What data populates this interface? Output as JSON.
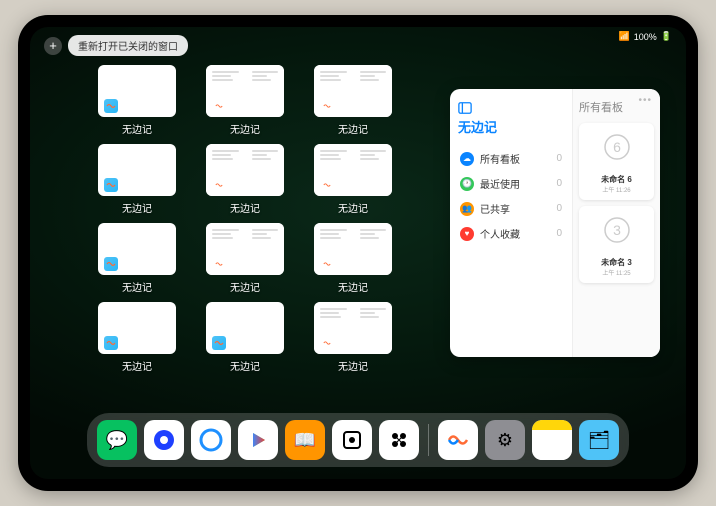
{
  "status": {
    "battery": "100%"
  },
  "topbar": {
    "button_label": "重新打开已关闭的窗口"
  },
  "thumb_label": "无边记",
  "thumbs": [
    {
      "type": "blank"
    },
    {
      "type": "split"
    },
    {
      "type": "split"
    },
    {
      "type": "blank"
    },
    {
      "type": "split"
    },
    {
      "type": "split"
    },
    {
      "type": "blank"
    },
    {
      "type": "split"
    },
    {
      "type": "split"
    },
    {
      "type": "blank"
    },
    {
      "type": "blank"
    },
    {
      "type": "split"
    }
  ],
  "panel": {
    "title": "无边记",
    "right_title": "所有看板",
    "items": [
      {
        "label": "所有看板",
        "count": "0",
        "color": "#0a84ff"
      },
      {
        "label": "最近使用",
        "count": "0",
        "color": "#34c759"
      },
      {
        "label": "已共享",
        "count": "0",
        "color": "#ff9500"
      },
      {
        "label": "个人收藏",
        "count": "0",
        "color": "#ff3b30"
      }
    ],
    "cards": [
      {
        "title": "未命名 6",
        "sub": "上午 11:26",
        "digit": "6"
      },
      {
        "title": "未命名 3",
        "sub": "上午 11:25",
        "digit": "3"
      }
    ]
  },
  "dock": {
    "apps": [
      {
        "name": "wechat",
        "bg": "#07c160",
        "glyph": "💬"
      },
      {
        "name": "quark",
        "bg": "#fff",
        "glyph": "◉"
      },
      {
        "name": "qqbrowser",
        "bg": "#fff",
        "glyph": "◯"
      },
      {
        "name": "play",
        "bg": "#fff",
        "glyph": "▶"
      },
      {
        "name": "books",
        "bg": "#ff9500",
        "glyph": "📖"
      },
      {
        "name": "app6",
        "bg": "#fff",
        "glyph": "⬛"
      },
      {
        "name": "app7",
        "bg": "#fff",
        "glyph": "✦"
      },
      {
        "name": "freeform",
        "bg": "#fff",
        "glyph": "〰"
      },
      {
        "name": "settings",
        "bg": "#8e8e93",
        "glyph": "⚙"
      },
      {
        "name": "notes",
        "bg": "#fff",
        "glyph": "📝"
      },
      {
        "name": "folder",
        "bg": "#4fc3f7",
        "glyph": "🗂"
      }
    ]
  }
}
